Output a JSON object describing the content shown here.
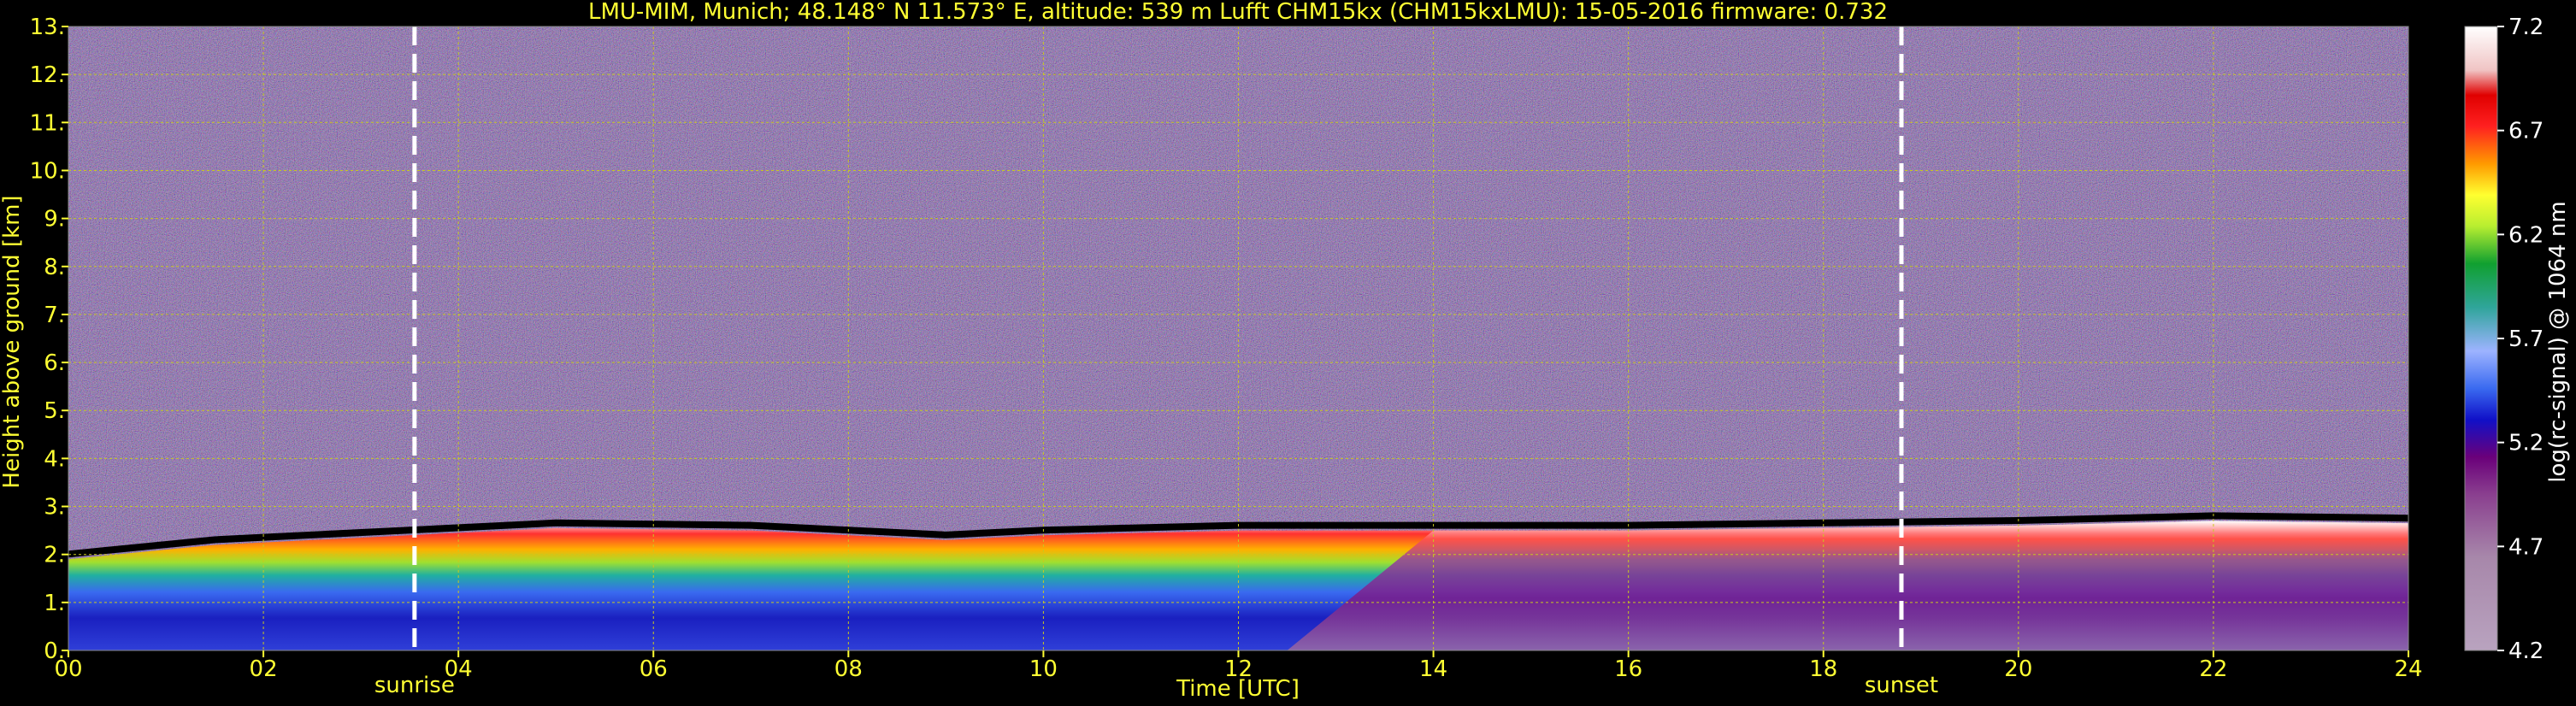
{
  "chart_data": {
    "type": "heatmap",
    "title": "LMU-MIM, Munich; 48.148° N 11.573° E, altitude: 539 m     Lufft CHM15kx (CHM15kxLMU): 15-05-2016     firmware: 0.732",
    "xlabel": "Time [UTC]",
    "ylabel": "Height above ground [km]",
    "xlim": [
      0,
      24
    ],
    "ylim": [
      0,
      13
    ],
    "x_ticks": [
      "00",
      "02",
      "04",
      "06",
      "08",
      "10",
      "12",
      "14",
      "16",
      "18",
      "20",
      "22",
      "24"
    ],
    "x_tick_values": [
      0,
      2,
      4,
      6,
      8,
      10,
      12,
      14,
      16,
      18,
      20,
      22,
      24
    ],
    "y_ticks": [
      "0.",
      "1.",
      "2.",
      "3.",
      "4.",
      "5.",
      "6.",
      "7.",
      "8.",
      "9.",
      "10.",
      "11.",
      "12.",
      "13."
    ],
    "y_tick_values": [
      0,
      1,
      2,
      3,
      4,
      5,
      6,
      7,
      8,
      9,
      10,
      11,
      12,
      13
    ],
    "grid": true,
    "colorbar": {
      "label": "log(rc-signal) @ 1064 nm",
      "range": [
        4.2,
        7.2
      ],
      "ticks": [
        "4.2",
        "4.7",
        "5.2",
        "5.7",
        "6.2",
        "6.7",
        "7.2"
      ],
      "tick_values": [
        4.2,
        4.7,
        5.2,
        5.7,
        6.2,
        6.7,
        7.2
      ]
    },
    "annotations": [
      {
        "label": "sunrise",
        "x": 3.55
      },
      {
        "label": "sunset",
        "x": 18.8
      }
    ],
    "boundary_layer_top_km": [
      [
        0,
        1.9
      ],
      [
        1.5,
        2.2
      ],
      [
        3.5,
        2.4
      ],
      [
        5,
        2.55
      ],
      [
        7,
        2.5
      ],
      [
        8,
        2.4
      ],
      [
        9,
        2.3
      ],
      [
        10,
        2.4
      ],
      [
        12,
        2.5
      ],
      [
        14,
        2.5
      ],
      [
        16,
        2.5
      ],
      [
        18,
        2.55
      ],
      [
        20,
        2.6
      ],
      [
        22,
        2.7
      ],
      [
        24,
        2.65
      ]
    ]
  }
}
